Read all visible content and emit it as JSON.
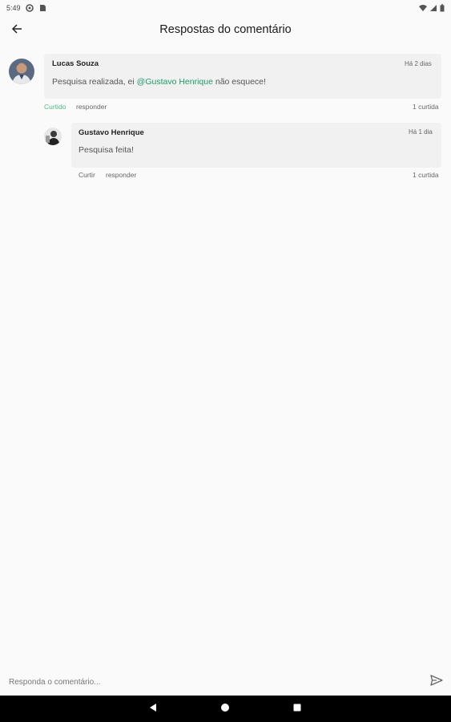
{
  "status_bar": {
    "time": "5:49"
  },
  "header": {
    "title": "Respostas do comentário"
  },
  "comment": {
    "author": "Lucas Souza",
    "time": "Há 2 dias",
    "text_before": "Pesquisa realizada, ei ",
    "mention": "@Gustavo Henrique",
    "text_after": " não esquece!",
    "like_label": "Curtido",
    "reply_label": "responder",
    "likes_count": "1 curtida"
  },
  "reply": {
    "author": "Gustavo Henrique",
    "time": "Há 1 dia",
    "text": "Pesquisa feita!",
    "like_label": "Curtir",
    "reply_label": "responder",
    "likes_count": "1 curtida"
  },
  "composer": {
    "placeholder": "Responda o comentário..."
  },
  "colors": {
    "accent": "#1a9c64",
    "liked": "#4cb88a"
  }
}
